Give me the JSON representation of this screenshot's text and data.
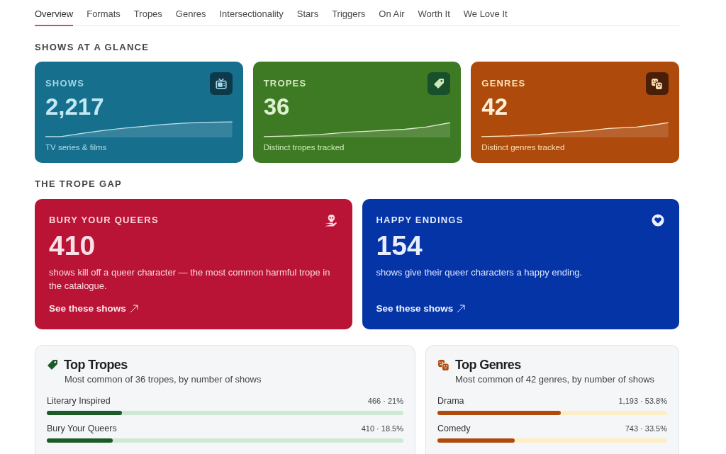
{
  "tabs": [
    {
      "label": "Overview",
      "selected": true
    },
    {
      "label": "Formats",
      "selected": false
    },
    {
      "label": "Tropes",
      "selected": false
    },
    {
      "label": "Genres",
      "selected": false
    },
    {
      "label": "Intersectionality",
      "selected": false
    },
    {
      "label": "Stars",
      "selected": false
    },
    {
      "label": "Triggers",
      "selected": false
    },
    {
      "label": "On Air",
      "selected": false
    },
    {
      "label": "Worth It",
      "selected": false
    },
    {
      "label": "We Love It",
      "selected": false
    }
  ],
  "glance": {
    "heading": "SHOWS AT A GLANCE",
    "cards": [
      {
        "label": "SHOWS",
        "value": "2,217",
        "caption": "TV series & films",
        "color": "#156f8d"
      },
      {
        "label": "TROPES",
        "value": "36",
        "caption": "Distinct tropes tracked",
        "color": "#3e7a23"
      },
      {
        "label": "GENRES",
        "value": "42",
        "caption": "Distinct genres tracked",
        "color": "#ad4a0c"
      }
    ]
  },
  "trope_gap": {
    "heading": "THE TROPE GAP",
    "cards": [
      {
        "label": "BURY YOUR QUEERS",
        "value": "410",
        "description": "shows kill off a queer character — the most common harmful trope in the catalogue.",
        "link": "See these shows",
        "color": "#b91436"
      },
      {
        "label": "HAPPY ENDINGS",
        "value": "154",
        "description": "shows give their queer characters a happy ending.",
        "link": "See these shows",
        "color": "#0434a6"
      }
    ]
  },
  "panels": [
    {
      "title": "Top Tropes",
      "subtitle": "Most common of 36 tropes, by number of shows",
      "color": "#1c5b26",
      "rows": [
        {
          "label": "Literary Inspired",
          "reading": "466 · 21%",
          "level": 0.21
        },
        {
          "label": "Bury Your Queers",
          "reading": "410 · 18.5%",
          "level": 0.185
        }
      ]
    },
    {
      "title": "Top Genres",
      "subtitle": "Most common of 42 genres, by number of shows",
      "color": "#b04a0c",
      "rows": [
        {
          "label": "Drama",
          "reading": "1,193 · 53.8%",
          "level": 0.538
        },
        {
          "label": "Comedy",
          "reading": "743 · 33.5%",
          "level": 0.335
        }
      ]
    }
  ]
}
